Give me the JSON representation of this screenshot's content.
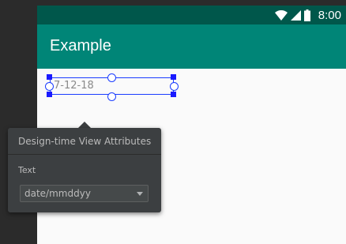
{
  "status_bar": {
    "time": "8:00",
    "icons": [
      "wifi-icon",
      "cellular-signal-icon",
      "battery-icon"
    ]
  },
  "app_bar": {
    "title": "Example"
  },
  "date_view": {
    "text": "7-12-18"
  },
  "design_popup": {
    "title": "Design-time View Attributes",
    "field_label": "Text",
    "field_value": "date/mmddyy"
  },
  "colors": {
    "status_bar": "#00574b",
    "app_bar": "#008577",
    "selection": "#1a3cff",
    "popup_bg": "#3c3f41",
    "editor_bg": "#2b2b2b"
  }
}
